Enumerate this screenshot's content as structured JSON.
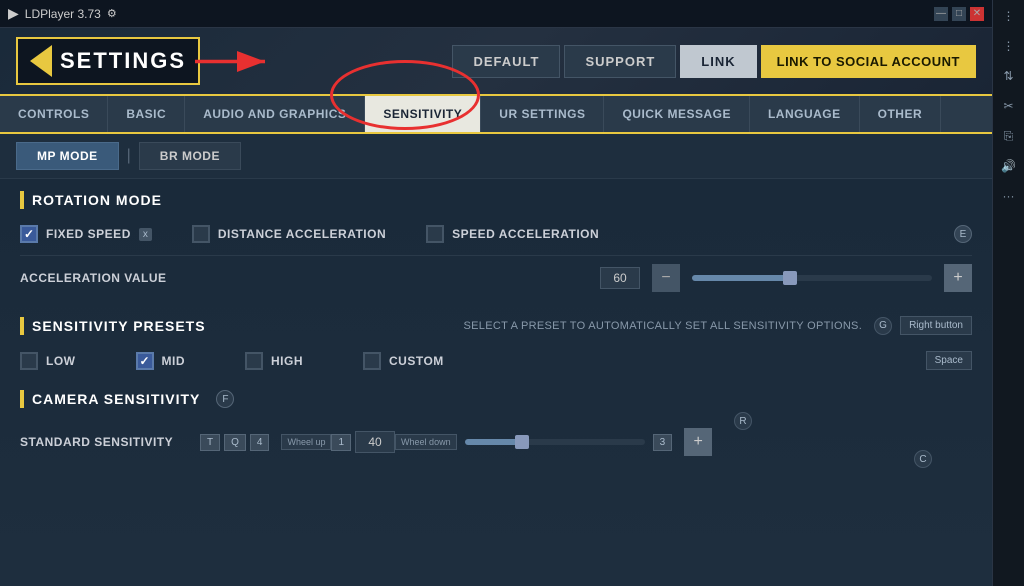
{
  "titlebar": {
    "app_name": "LDPlayer 3.73",
    "controls": [
      "—",
      "□",
      "✕"
    ]
  },
  "header": {
    "logo_text": "SETTINGS",
    "buttons": [
      "DEFAULT",
      "SUPPORT",
      "LINK"
    ],
    "active_button": "LINK",
    "link_social": "LINK TO SOCIAL ACCOUNT"
  },
  "nav": {
    "tabs": [
      "CONTROLS",
      "BASIC",
      "AUDIO AND GRAPHICS",
      "SENSITIVITY",
      "UR SETTINGS",
      "QUICK MESSAGE",
      "LANGUAGE",
      "OTHER"
    ],
    "active_tab": "SENSITIVITY"
  },
  "mode_tabs": {
    "tabs": [
      "MP MODE",
      "BR MODE"
    ],
    "active_tab": "MP MODE"
  },
  "rotation_mode": {
    "title": "ROTATION MODE",
    "options": [
      {
        "label": "FIXED SPEED",
        "checked": true,
        "badge": "x"
      },
      {
        "label": "DISTANCE ACCELERATION",
        "checked": false
      },
      {
        "label": "SPEED ACCELERATION",
        "checked": false
      }
    ],
    "e_badge": "E",
    "acceleration_label": "ACCELERATION VALUE",
    "acceleration_value": "60"
  },
  "sensitivity_presets": {
    "title": "SENSITIVITY PRESETS",
    "info": "SELECT A PRESET TO AUTOMATICALLY SET ALL SENSITIVITY OPTIONS.",
    "g_badge": "G",
    "right_button_label": "Right button",
    "presets": [
      {
        "label": "LOW",
        "checked": false
      },
      {
        "label": "MID",
        "checked": true
      },
      {
        "label": "HIGH",
        "checked": false
      },
      {
        "label": "CUSTOM",
        "checked": false
      }
    ],
    "space_badge": "Space"
  },
  "camera_sensitivity": {
    "title": "CAMERA SENSITIVITY",
    "f_badge": "F",
    "r_badge": "R",
    "c_badge": "C",
    "standard_label": "STANDARD SENSITIVITY",
    "keys": [
      "T",
      "Q",
      "4"
    ],
    "wheel_up": "Wheel up",
    "wheel_up_num": "1",
    "value": "40",
    "wheel_down": "Wheel down",
    "wheel_down_num": "3"
  }
}
